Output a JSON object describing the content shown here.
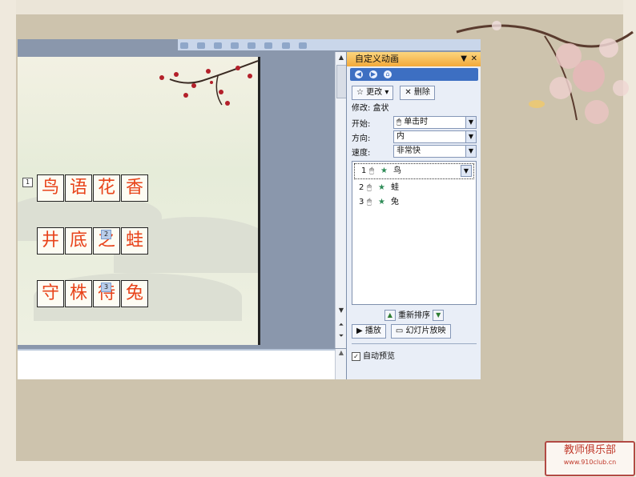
{
  "taskpane": {
    "title": "自定义动画",
    "change_btn": "更改",
    "delete_btn": "删除",
    "modify_label": "修改: 盒状",
    "start_label": "开始:",
    "start_value": "单击时",
    "direction_label": "方向:",
    "direction_value": "内",
    "speed_label": "速度:",
    "speed_value": "非常快",
    "items": [
      {
        "num": "1",
        "name": "鸟"
      },
      {
        "num": "2",
        "name": "蛙"
      },
      {
        "num": "3",
        "name": "兔"
      }
    ],
    "reorder_label": "重新排序",
    "play_btn": "播放",
    "slideshow_btn": "幻灯片放映",
    "autopreview_label": "自动预览"
  },
  "slide": {
    "rows": [
      {
        "tag": "1",
        "chars": [
          "鸟",
          "语",
          "花",
          "香"
        ]
      },
      {
        "tag": "2",
        "chars": [
          "井",
          "底",
          "之",
          "蛙"
        ]
      },
      {
        "tag": "3",
        "chars": [
          "守",
          "株",
          "待",
          "兔"
        ]
      }
    ]
  },
  "stamp": {
    "line1": "教师俱乐部",
    "line2": "www.910club.cn"
  }
}
